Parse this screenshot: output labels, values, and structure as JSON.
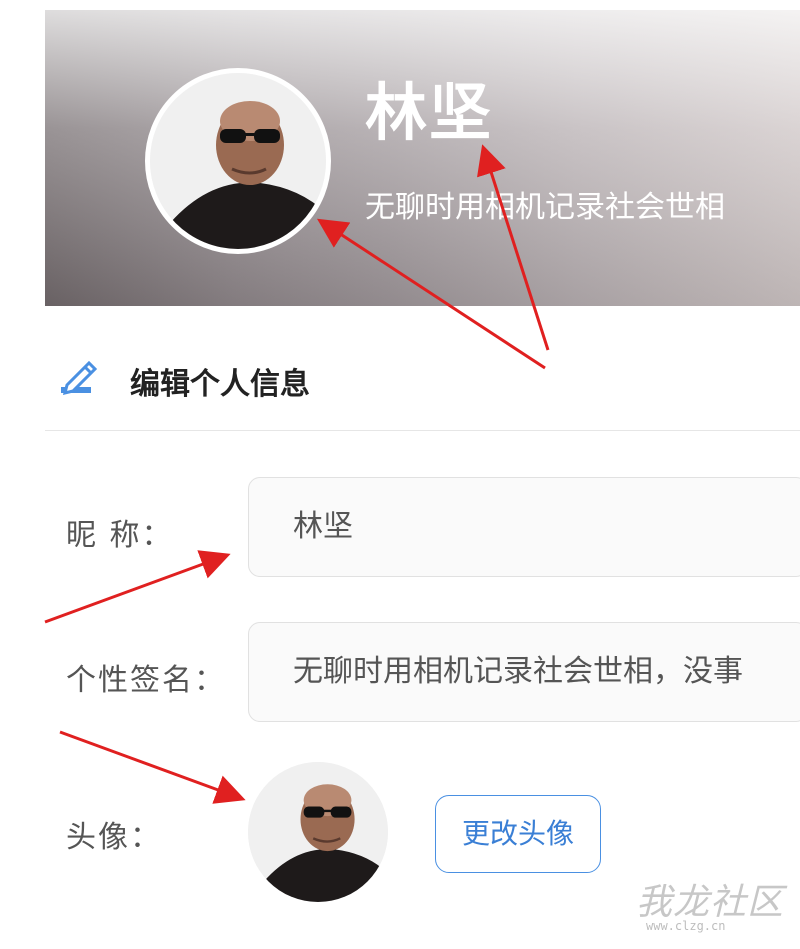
{
  "profile": {
    "name": "林坚",
    "signature": "无聊时用相机记录社会世相"
  },
  "section": {
    "title": "编辑个人信息",
    "icon": "edit-pencil-icon"
  },
  "form": {
    "nickname_label": "昵 称：",
    "nickname_value": "林坚",
    "signature_label": "个性签名：",
    "signature_value": "无聊时用相机记录社会世相，没事",
    "avatar_label": "头像：",
    "change_avatar_button": "更改头像"
  },
  "watermark": {
    "text": "我龙社区",
    "url": "www.clzg.cn"
  },
  "colors": {
    "accent": "#4a90e2",
    "arrow": "#e02020"
  }
}
